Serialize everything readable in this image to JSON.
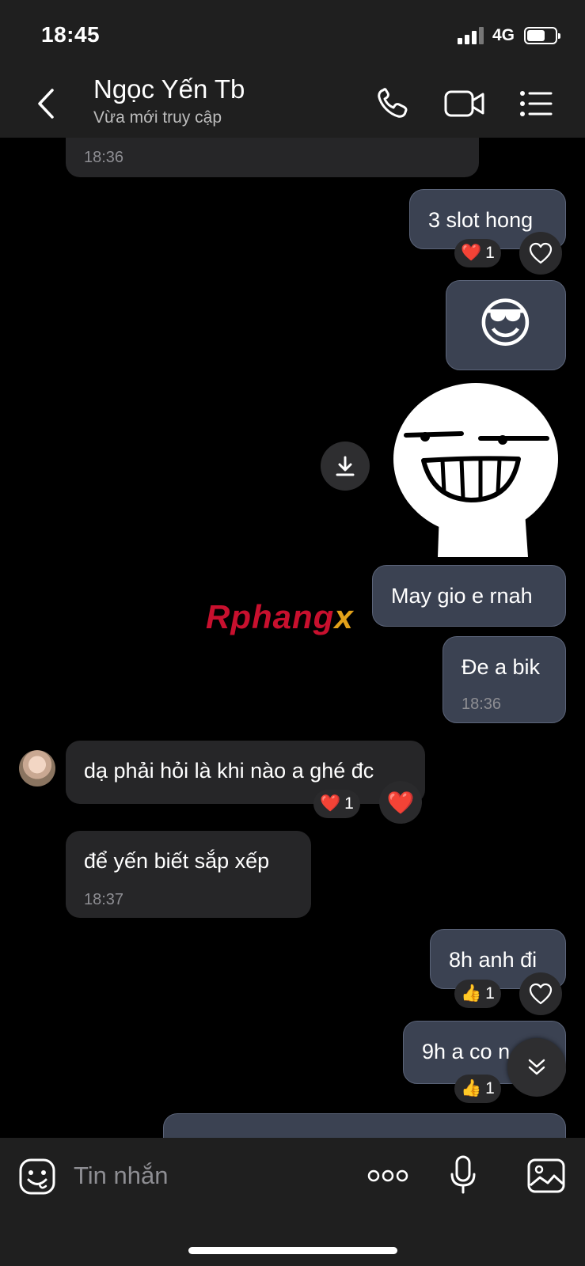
{
  "status": {
    "time": "18:45",
    "network": "4G",
    "battery_level": 0.65
  },
  "header": {
    "contact_name": "Ngọc Yến Tb",
    "presence": "Vừa mới truy cập"
  },
  "messages": {
    "m0_time": "18:36",
    "m1_text": "3 slot hong",
    "m1_react_count": "1",
    "m2_emoji": "😎",
    "m4_text": "May gio e rnah",
    "m5_text": "Đe a bik",
    "m5_time": "18:36",
    "m6_text": "dạ phải hỏi là khi nào a ghé đc",
    "m6_react_count": "1",
    "m7_text": "để yến biết sắp xếp",
    "m7_time": "18:37",
    "m8_text": "8h anh đi",
    "m8_react_count": "1",
    "m9_text": "9h a co n",
    "m9_react_count": "1"
  },
  "watermark": {
    "text_red": "Rphang",
    "text_gold": "x"
  },
  "input": {
    "placeholder": "Tin nhắn"
  },
  "colors": {
    "bubble_out": "#3b4252",
    "bubble_in": "#262628",
    "background": "#000000",
    "bar": "#1f1f1f"
  }
}
